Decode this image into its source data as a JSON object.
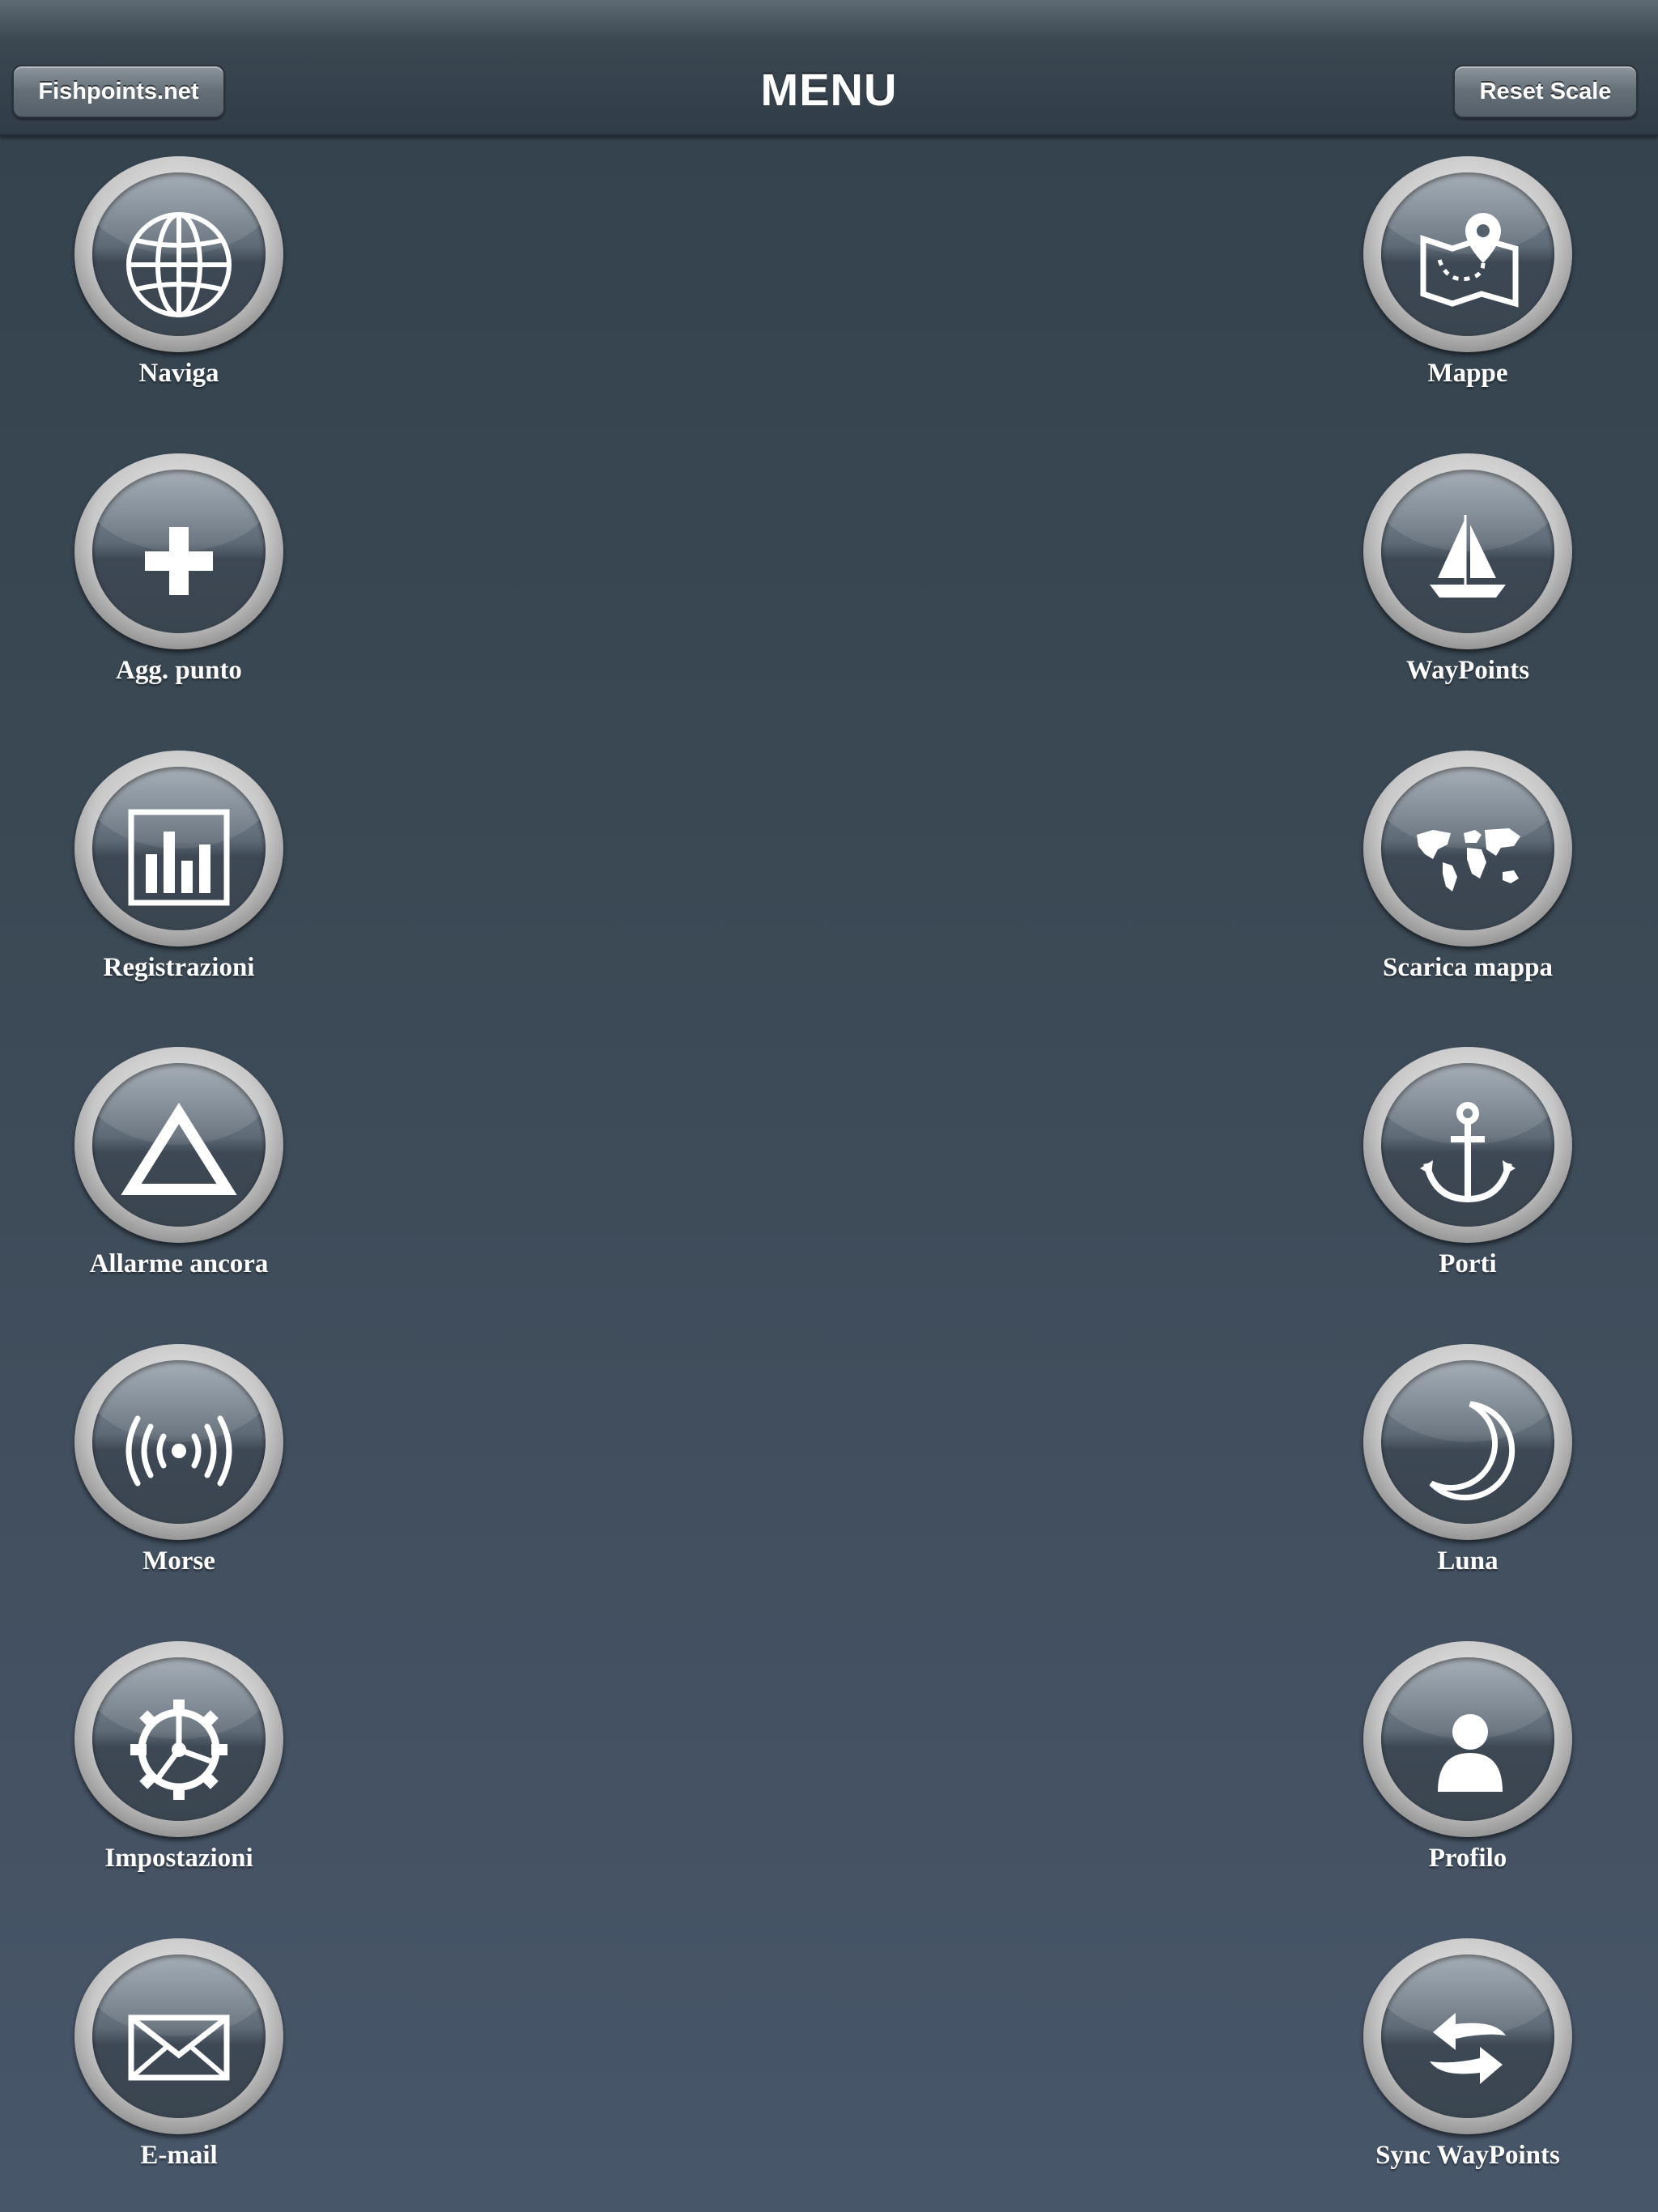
{
  "navbar": {
    "title": "MENU",
    "left_button": "Fishpoints.net",
    "right_button": "Reset Scale"
  },
  "menu": {
    "left": [
      {
        "label": "Naviga",
        "icon": "globe-icon"
      },
      {
        "label": "Agg. punto",
        "icon": "plus-icon"
      },
      {
        "label": "Registrazioni",
        "icon": "bar-chart-icon"
      },
      {
        "label": "Allarme ancora",
        "icon": "triangle-icon"
      },
      {
        "label": "Morse",
        "icon": "signal-icon"
      },
      {
        "label": "Impostazioni",
        "icon": "gear-icon"
      },
      {
        "label": "E-mail",
        "icon": "envelope-icon"
      }
    ],
    "right": [
      {
        "label": "Mappe",
        "icon": "map-pin-icon"
      },
      {
        "label": "WayPoints",
        "icon": "sailboat-icon"
      },
      {
        "label": "Scarica mappa",
        "icon": "world-map-icon"
      },
      {
        "label": "Porti",
        "icon": "anchor-icon"
      },
      {
        "label": "Luna",
        "icon": "moon-icon"
      },
      {
        "label": "Profilo",
        "icon": "person-icon"
      },
      {
        "label": "Sync WayPoints",
        "icon": "sync-arrows-icon"
      }
    ]
  }
}
